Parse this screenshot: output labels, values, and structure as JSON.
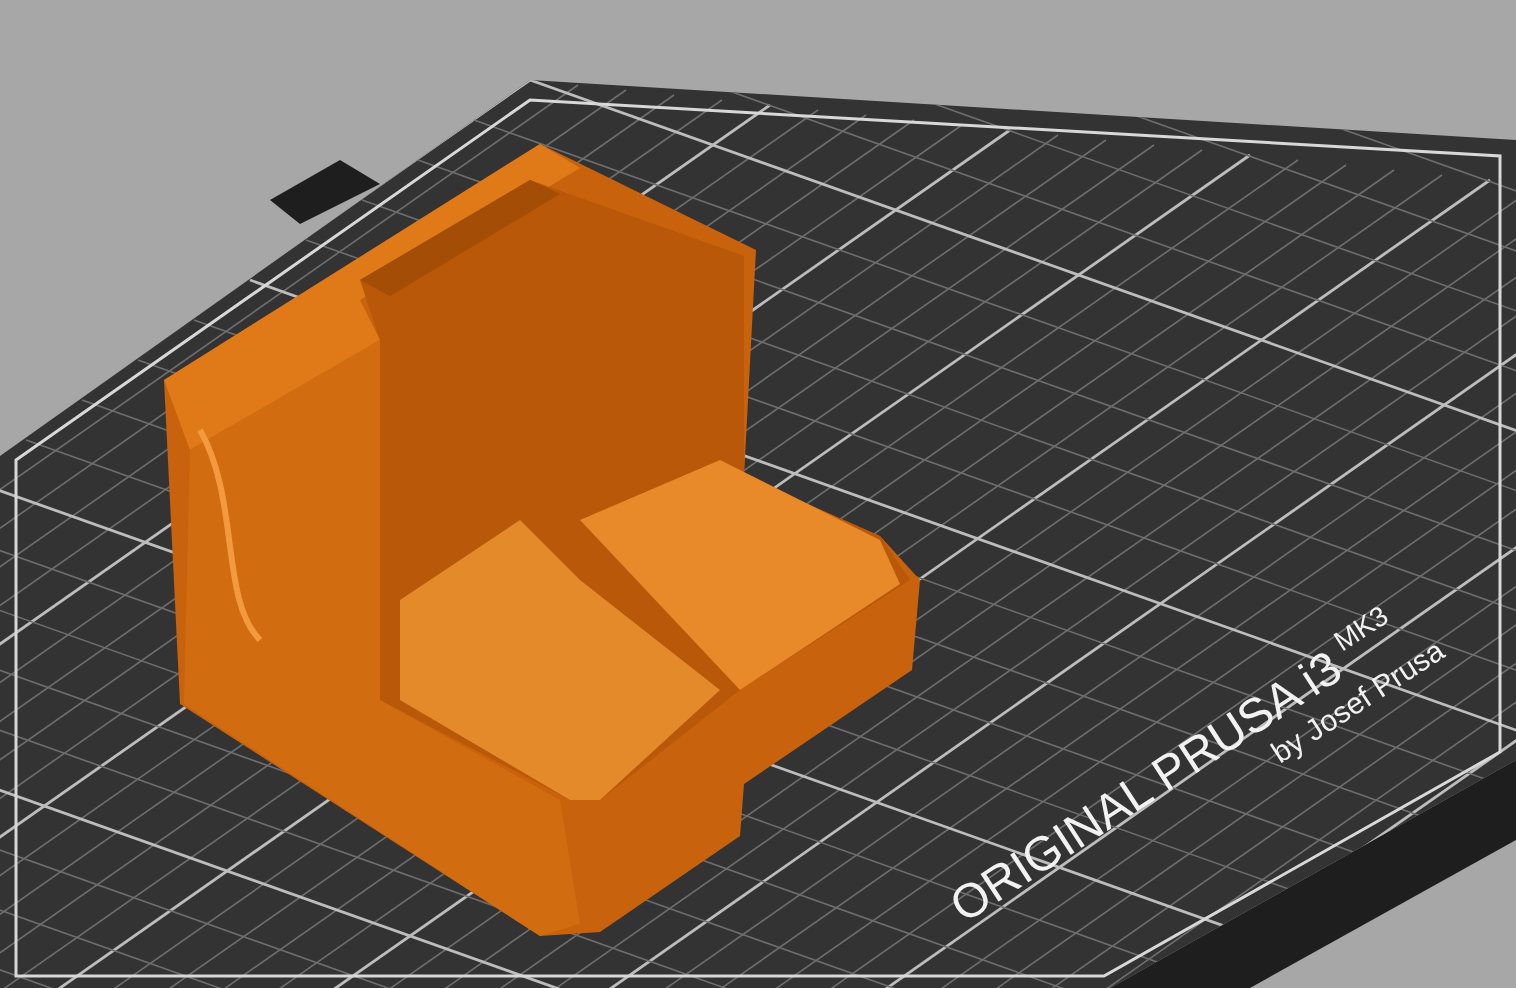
{
  "bed": {
    "logo_text": "ORIGINAL PRUSA i3",
    "model_text": "MK3",
    "byline": "by Josef Prusa"
  }
}
